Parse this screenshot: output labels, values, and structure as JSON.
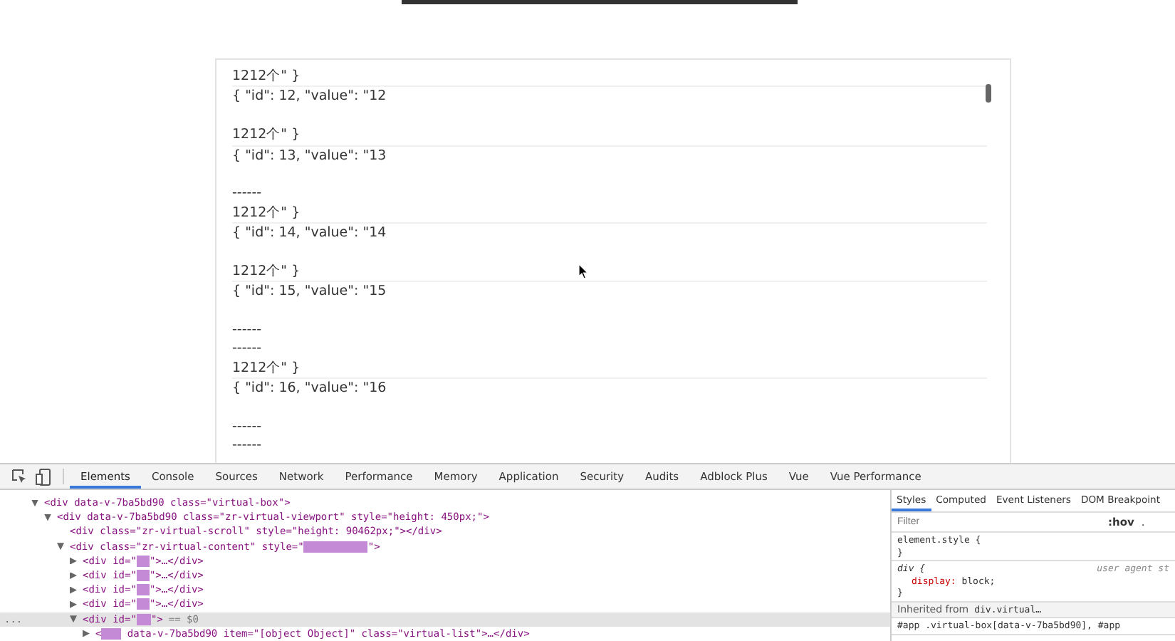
{
  "list": {
    "top_line": "1212个\" }",
    "items": [
      {
        "lines": [
          "{ \"id\": 12, \"value\": \"12",
          "1212个\" }"
        ]
      },
      {
        "lines": [
          "{ \"id\": 13, \"value\": \"13",
          "------",
          "1212个\" }"
        ]
      },
      {
        "lines": [
          "{ \"id\": 14, \"value\": \"14",
          "1212个\" }"
        ]
      },
      {
        "lines": [
          "{ \"id\": 15, \"value\": \"15",
          "------",
          "------",
          "1212个\" }"
        ]
      },
      {
        "lines": [
          "{ \"id\": 16, \"value\": \"16",
          "------",
          "------"
        ]
      }
    ]
  },
  "devtools": {
    "tabs": [
      {
        "label": "Elements",
        "selected": true
      },
      {
        "label": "Console",
        "selected": false
      },
      {
        "label": "Sources",
        "selected": false
      },
      {
        "label": "Network",
        "selected": false
      },
      {
        "label": "Performance",
        "selected": false
      },
      {
        "label": "Memory",
        "selected": false
      },
      {
        "label": "Application",
        "selected": false
      },
      {
        "label": "Security",
        "selected": false
      },
      {
        "label": "Audits",
        "selected": false
      },
      {
        "label": "Adblock Plus",
        "selected": false
      },
      {
        "label": "Vue",
        "selected": false
      },
      {
        "label": "Vue Performance",
        "selected": false
      }
    ],
    "tree": [
      {
        "text": "<div data-v-7ba5bd90 class=\"virtual-box\">",
        "expanded": true,
        "selected": false,
        "children": [
          {
            "text": "<div data-v-7ba5bd90 class=\"zr-virtual-viewport\" style=\"height: 450px;\">",
            "expanded": true,
            "selected": false,
            "children": [
              {
                "text": "<div class=\"zr-virtual-scroll\" style=\"height: 90462px;\"></div>",
                "selected": false
              },
              {
                "text": "<div class=\"zr-virtual-content\" style=\"",
                "highlight": true,
                "after": "\">",
                "expanded": true,
                "selected": false,
                "children": [
                  {
                    "text": "<div id=\"",
                    "highlight": true,
                    "after": "\">…</div>",
                    "expanded": false,
                    "selected": false
                  },
                  {
                    "text": "<div id=\"",
                    "highlight": true,
                    "after": "\">…</div>",
                    "expanded": false,
                    "selected": false
                  },
                  {
                    "text": "<div id=\"",
                    "highlight": true,
                    "after": "\">…</div>",
                    "expanded": false,
                    "selected": false
                  },
                  {
                    "text": "<div id=\"",
                    "highlight": true,
                    "after": "\">…</div>",
                    "expanded": false,
                    "selected": false
                  },
                  {
                    "text": "<div id=\"",
                    "highlight": true,
                    "after": "\">",
                    "note": "== $0",
                    "expanded": true,
                    "selected": true,
                    "children": [
                      {
                        "text": "<",
                        "highlight": true,
                        "after": " data-v-7ba5bd90 item=\"[object Object]\" class=\"virtual-list\">…</div>",
                        "expanded": false,
                        "selected": false
                      }
                    ]
                  }
                ]
              }
            ]
          }
        ]
      }
    ],
    "selected_marker": "...",
    "side_tabs": [
      {
        "label": "Styles",
        "selected": true
      },
      {
        "label": "Computed",
        "selected": false
      },
      {
        "label": "Event Listeners",
        "selected": false
      },
      {
        "label": "DOM Breakpoint",
        "selected": false
      }
    ],
    "filter": {
      "placeholder": "Filter"
    },
    "hov": ":hov",
    "cls": ".",
    "rules": [
      {
        "kind": "block",
        "lines": [
          "element.style {",
          "}"
        ]
      },
      {
        "kind": "ua",
        "selector": "div {",
        "origin": "user agent st",
        "property": "display:",
        "value": "block;",
        "close": "}"
      },
      {
        "kind": "inherited",
        "label": "Inherited from",
        "link": "div.virtual…"
      },
      {
        "kind": "block",
        "lines": [
          "#app .virtual-box[data-v-7ba5bd90], #app"
        ]
      }
    ]
  }
}
